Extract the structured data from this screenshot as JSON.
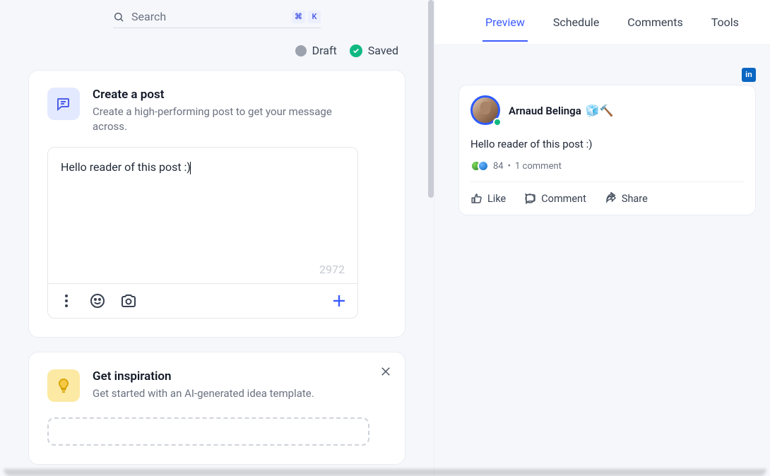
{
  "search": {
    "placeholder": "Search",
    "kbd1": "⌘",
    "kbd2": "K"
  },
  "status": {
    "draft": "Draft",
    "saved": "Saved"
  },
  "create": {
    "title": "Create a post",
    "subtitle": "Create a high-performing post to get your message across.",
    "text": "Hello reader of this post :)",
    "char_count": "2972"
  },
  "inspiration": {
    "title": "Get inspiration",
    "subtitle": "Get started with an AI-generated idea template."
  },
  "tabs": {
    "preview": "Preview",
    "schedule": "Schedule",
    "comments": "Comments",
    "tools": "Tools"
  },
  "linkedin_badge": "in",
  "preview": {
    "author": "Arnaud Belinga",
    "author_emoji": "🧊🔨",
    "body": "Hello reader of this post :)",
    "reactions": "84",
    "comments": "1 comment",
    "like": "Like",
    "comment": "Comment",
    "share": "Share"
  }
}
